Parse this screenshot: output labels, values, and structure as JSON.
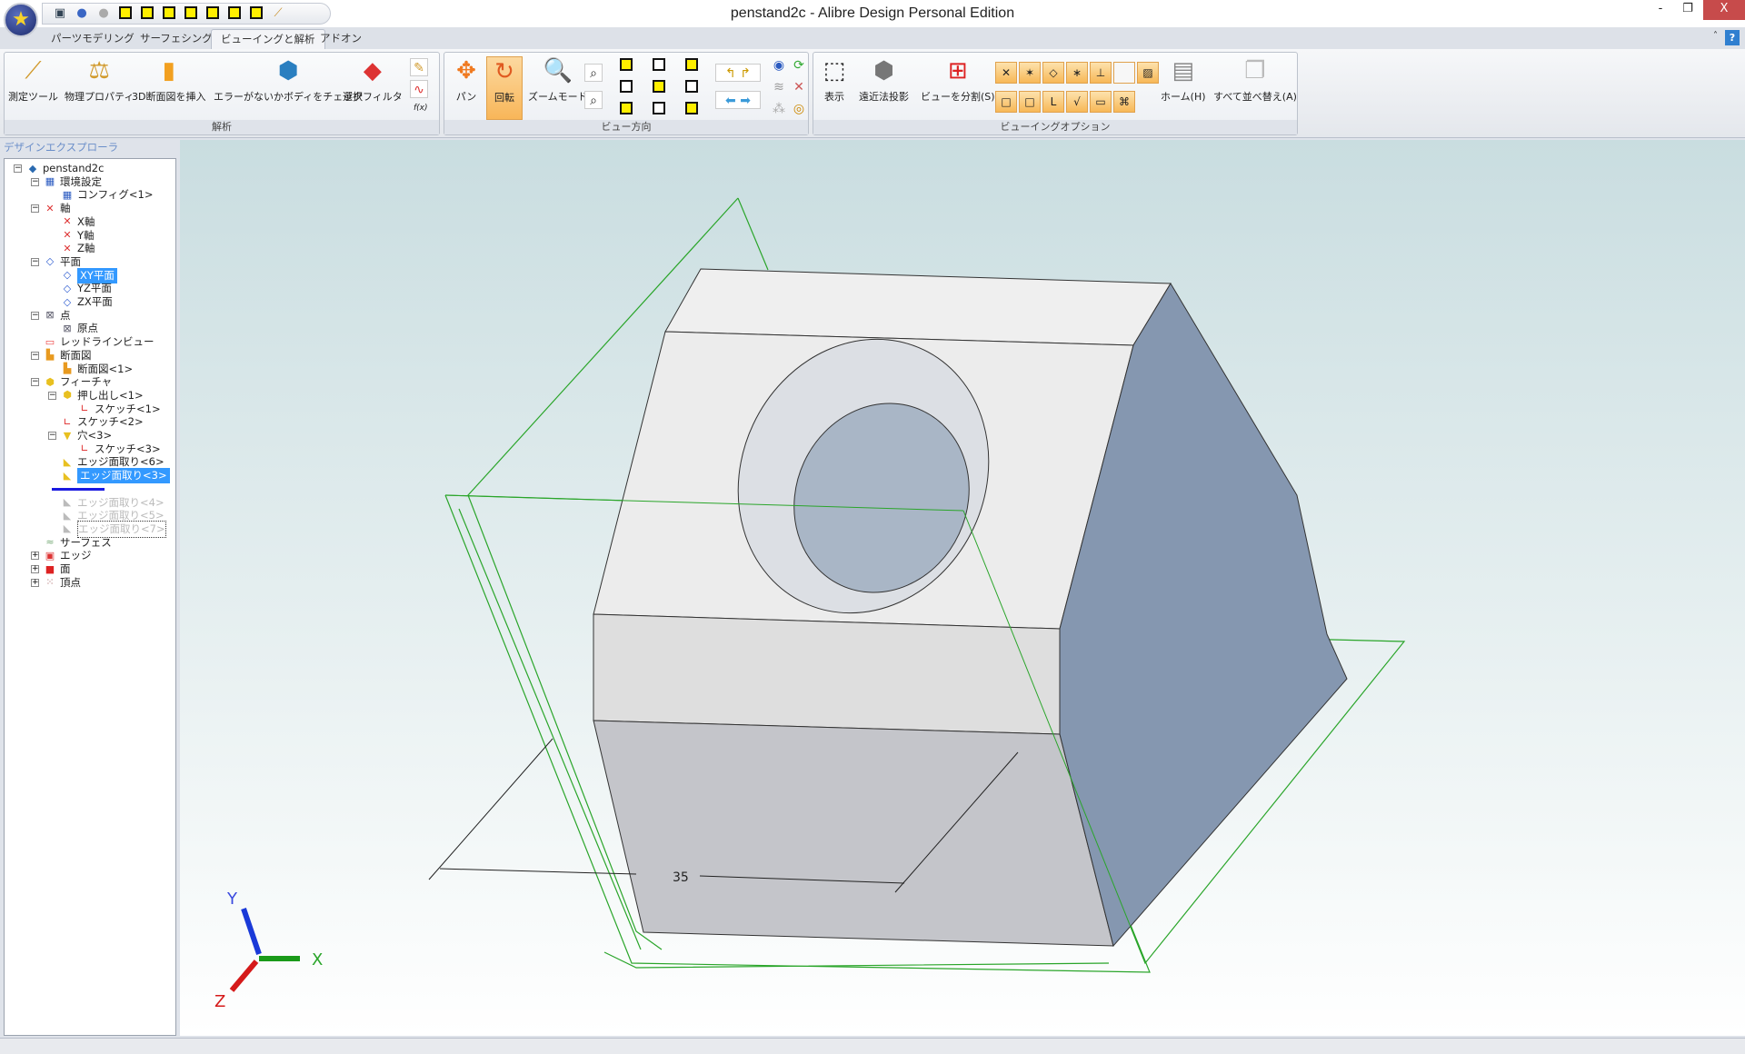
{
  "window": {
    "title": "penstand2c - Alibre Design Personal Edition",
    "minimize": "-",
    "restore": "❐",
    "close": "X"
  },
  "quick_access": [
    "save-icon",
    "undo-icon",
    "redo-icon",
    "view-cube-icon",
    "view-cube-icon",
    "view-cube-icon",
    "view-cube-icon",
    "view-cube-icon",
    "view-cube-icon",
    "view-cube-icon",
    "measure-icon"
  ],
  "tabs": [
    {
      "label": "パーツモデリング"
    },
    {
      "label": "サーフェシング"
    },
    {
      "label": "ビューイングと解析",
      "active": true
    },
    {
      "label": "アドオン"
    }
  ],
  "ribbon": {
    "analysis": {
      "label": "解析",
      "buttons": [
        "測定ツール",
        "物理プロパティ",
        "3D断面図を挿入",
        "エラーがないかボディをチェック",
        "選択フィルタ"
      ],
      "fx": "f(x)"
    },
    "view_direction": {
      "label": "ビュー方向",
      "buttons": [
        "パン",
        "回転",
        "ズームモード"
      ]
    },
    "viewing_options": {
      "label": "ビューイングオプション",
      "buttons": [
        "表示",
        "遠近法投影",
        "ビューを分割(S)",
        "ホーム(H)",
        "すべて並べ替え(A)"
      ]
    }
  },
  "explorer": {
    "title": "デザインエクスプローラ",
    "nodes": [
      {
        "label": "penstand2c",
        "level": 0
      },
      {
        "label": "環境設定",
        "level": 1
      },
      {
        "label": "コンフィグ<1>",
        "level": 2
      },
      {
        "label": "軸",
        "level": 1
      },
      {
        "label": "X軸",
        "level": 2
      },
      {
        "label": "Y軸",
        "level": 2
      },
      {
        "label": "Z軸",
        "level": 2
      },
      {
        "label": "平面",
        "level": 1
      },
      {
        "label": "XY平面",
        "level": 2,
        "selected": true
      },
      {
        "label": "YZ平面",
        "level": 2
      },
      {
        "label": "ZX平面",
        "level": 2
      },
      {
        "label": "点",
        "level": 1
      },
      {
        "label": "原点",
        "level": 2
      },
      {
        "label": "レッドラインビュー",
        "level": 1
      },
      {
        "label": "断面図",
        "level": 1
      },
      {
        "label": "断面図<1>",
        "level": 2
      },
      {
        "label": "フィーチャ",
        "level": 1
      },
      {
        "label": "押し出し<1>",
        "level": 2
      },
      {
        "label": "スケッチ<1>",
        "level": 3
      },
      {
        "label": "スケッチ<2>",
        "level": 2
      },
      {
        "label": "穴<3>",
        "level": 2
      },
      {
        "label": "スケッチ<3>",
        "level": 3
      },
      {
        "label": "エッジ面取り<6>",
        "level": 2
      },
      {
        "label": "エッジ面取り<3>",
        "level": 2,
        "selected": true
      },
      {
        "label": "",
        "level": 2,
        "rollback_bar": true
      },
      {
        "label": "エッジ面取り<4>",
        "level": 2,
        "suppressed": true
      },
      {
        "label": "エッジ面取り<5>",
        "level": 2,
        "suppressed": true
      },
      {
        "label": "エッジ面取り<7>",
        "level": 2,
        "suppressed": true,
        "focused": true
      },
      {
        "label": "サーフェス",
        "level": 1
      },
      {
        "label": "エッジ",
        "level": 1
      },
      {
        "label": "面",
        "level": 1
      },
      {
        "label": "頂点",
        "level": 1
      }
    ]
  },
  "viewport": {
    "dimension": "35",
    "triad": {
      "x": "X",
      "y": "Y",
      "z": "Z"
    }
  },
  "colors": {
    "selection": "#3399ff",
    "sketch_plane": "#22aa22",
    "face_right": "#8597b0",
    "active_tab": "#f3f4f7"
  }
}
